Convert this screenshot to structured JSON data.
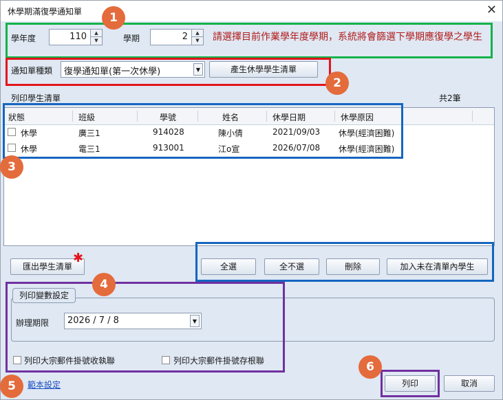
{
  "window": {
    "title": "休學期滿復學通知單",
    "close_glyph": "✕"
  },
  "top": {
    "year_label": "學年度",
    "year_value": "110",
    "term_label": "學期",
    "term_value": "2",
    "hint": "請選擇目前作業學年度學期，系統將會篩選下學期應復學之學生"
  },
  "notice": {
    "label": "通知單種類",
    "selected": "復學通知單(第一次休學)",
    "generate_button": "產生休學學生清單"
  },
  "list": {
    "title": "列印學生清單",
    "count": "共2筆",
    "columns": [
      "狀態",
      "班級",
      "學號",
      "姓名",
      "休學日期",
      "休學原因"
    ],
    "rows": [
      {
        "status": "休學",
        "class": "廣三1",
        "id": "914028",
        "name": "陳小倩",
        "date": "2021/09/03",
        "reason": "休學(經濟困難)"
      },
      {
        "status": "休學",
        "class": "電三1",
        "id": "913001",
        "name": "江o宣",
        "date": "2026/07/08",
        "reason": "休學(經濟困難)"
      }
    ]
  },
  "actions": {
    "export": "匯出學生清單",
    "select_all": "全選",
    "deselect_all": "全不選",
    "delete": "刪除",
    "add_missing": "加入未在清單內學生"
  },
  "print_settings": {
    "title": "列印變數設定",
    "deadline_label": "辦理期限",
    "deadline_value": "2026 / 7 / 8",
    "receipt_label": "列印大宗郵件掛號收執聯",
    "stub_label": "列印大宗郵件掛號存根聯"
  },
  "footer": {
    "template_link": "範本設定",
    "print": "列印",
    "cancel": "取消"
  },
  "markers": [
    "1",
    "2",
    "3",
    "4",
    "5",
    "6"
  ],
  "colors": {
    "green": "#13b24a",
    "red": "#e3141c",
    "blue": "#1565c0",
    "purple": "#7030a0",
    "marker": "#e46b3b",
    "hint": "#b11c1c"
  }
}
